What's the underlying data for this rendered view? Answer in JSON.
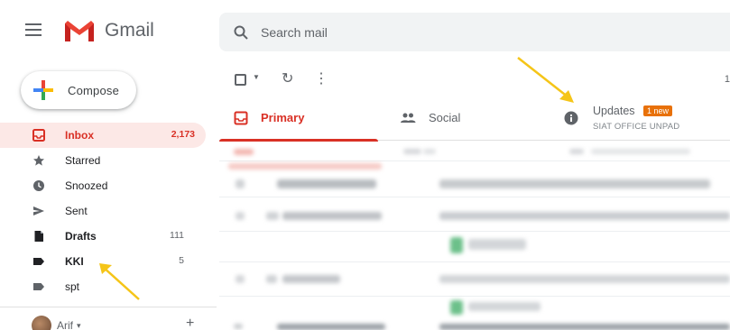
{
  "header": {
    "app_name": "Gmail",
    "search_placeholder": "Search mail"
  },
  "compose": {
    "label": "Compose"
  },
  "sidebar": {
    "items": [
      {
        "label": "Inbox",
        "count": "2,173",
        "icon": "inbox-icon",
        "active": true
      },
      {
        "label": "Starred",
        "count": "",
        "icon": "star-icon"
      },
      {
        "label": "Snoozed",
        "count": "",
        "icon": "clock-icon"
      },
      {
        "label": "Sent",
        "count": "",
        "icon": "send-icon"
      },
      {
        "label": "Drafts",
        "count": "111",
        "icon": "draft-icon"
      },
      {
        "label": "KKI",
        "count": "5",
        "icon": "label-icon"
      },
      {
        "label": "spt",
        "count": "",
        "icon": "label-icon"
      }
    ],
    "account": {
      "name": "Arif",
      "caret": "▾"
    }
  },
  "toolbar": {
    "pager": "1"
  },
  "tabs": {
    "primary": {
      "label": "Primary"
    },
    "social": {
      "label": "Social"
    },
    "updates": {
      "label": "Updates",
      "badge": "1 new",
      "subtitle": "SIAT OFFICE UNPAD"
    }
  },
  "colors": {
    "accent": "#d93025",
    "badge": "#e8710a",
    "annotation_arrow": "#f5c518"
  }
}
